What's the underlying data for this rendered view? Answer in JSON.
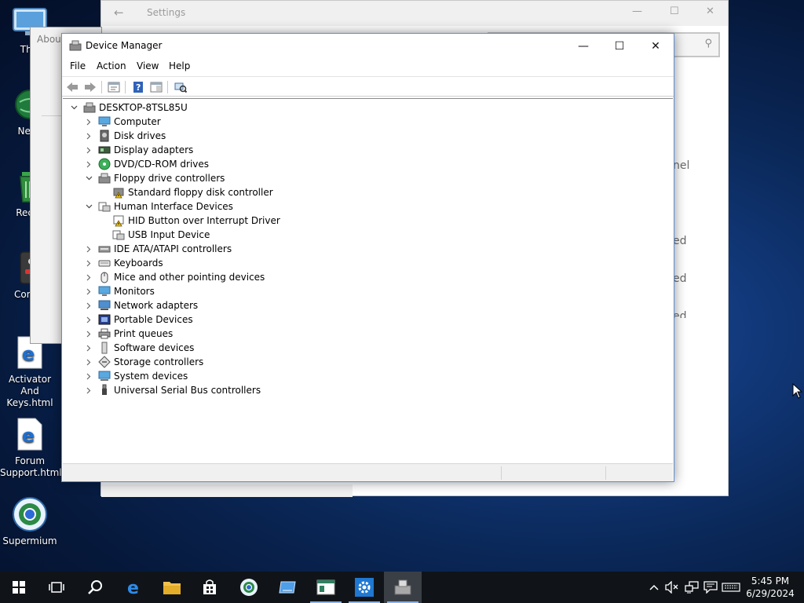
{
  "desktop": {
    "icons": [
      {
        "label": "This PC",
        "icon": "monitor-icon"
      },
      {
        "label": "Network",
        "icon": "network-globe-icon"
      },
      {
        "label": "Recycle Bin",
        "icon": "recycle-bin-icon"
      },
      {
        "label": "Control Panel",
        "icon": "control-panel-icon"
      },
      {
        "label": "Activator And Keys.html",
        "icon": "edge-html-file-icon"
      },
      {
        "label": "Forum Support.html",
        "icon": "edge-html-file-icon"
      },
      {
        "label": "Supermium",
        "icon": "supermium-browser-icon"
      }
    ],
    "truncated_labels": [
      "This",
      "Netw",
      "Recyc",
      "Contro"
    ]
  },
  "about_window": {
    "title": "About"
  },
  "settings_window": {
    "title": "Settings",
    "fragments": [
      "nel",
      "ed",
      "ed",
      "ed"
    ]
  },
  "device_manager": {
    "title": "Device Manager",
    "menu": [
      "File",
      "Action",
      "View",
      "Help"
    ],
    "toolbar": [
      "back-arrow-icon",
      "forward-arrow-icon",
      "properties-icon",
      "help-icon",
      "view-icon",
      "scan-hardware-icon"
    ],
    "tree_root": "DESKTOP-8TSL85U",
    "categories": [
      {
        "label": "Computer",
        "icon": "computer-icon",
        "expanded": false,
        "children": []
      },
      {
        "label": "Disk drives",
        "icon": "disk-drive-icon",
        "expanded": false,
        "children": []
      },
      {
        "label": "Display adapters",
        "icon": "display-adapter-icon",
        "expanded": false,
        "children": []
      },
      {
        "label": "DVD/CD-ROM drives",
        "icon": "dvd-icon",
        "expanded": false,
        "children": []
      },
      {
        "label": "Floppy drive controllers",
        "icon": "floppy-controller-icon",
        "expanded": true,
        "children": [
          {
            "label": "Standard floppy disk controller",
            "icon": "warning-device-icon"
          }
        ]
      },
      {
        "label": "Human Interface Devices",
        "icon": "hid-icon",
        "expanded": true,
        "children": [
          {
            "label": "HID Button over Interrupt Driver",
            "icon": "warning-device-icon"
          },
          {
            "label": "USB Input Device",
            "icon": "hid-device-icon"
          }
        ]
      },
      {
        "label": "IDE ATA/ATAPI controllers",
        "icon": "ide-controller-icon",
        "expanded": false,
        "children": []
      },
      {
        "label": "Keyboards",
        "icon": "keyboard-icon",
        "expanded": false,
        "children": []
      },
      {
        "label": "Mice and other pointing devices",
        "icon": "mouse-icon",
        "expanded": false,
        "children": []
      },
      {
        "label": "Monitors",
        "icon": "monitor-icon",
        "expanded": false,
        "children": []
      },
      {
        "label": "Network adapters",
        "icon": "network-adapter-icon",
        "expanded": false,
        "children": []
      },
      {
        "label": "Portable Devices",
        "icon": "portable-device-icon",
        "expanded": false,
        "children": []
      },
      {
        "label": "Print queues",
        "icon": "printer-icon",
        "expanded": false,
        "children": []
      },
      {
        "label": "Software devices",
        "icon": "software-device-icon",
        "expanded": false,
        "children": []
      },
      {
        "label": "Storage controllers",
        "icon": "storage-controller-icon",
        "expanded": false,
        "children": []
      },
      {
        "label": "System devices",
        "icon": "system-device-icon",
        "expanded": false,
        "children": []
      },
      {
        "label": "Universal Serial Bus controllers",
        "icon": "usb-icon",
        "expanded": false,
        "children": []
      }
    ]
  },
  "taskbar": {
    "items": [
      "start-icon",
      "task-view-icon",
      "search-icon",
      "edge-icon",
      "file-explorer-icon",
      "store-icon",
      "supermium-icon",
      "device-manager-shortcut-icon",
      "app-icon",
      "settings-gear-icon",
      "device-manager-icon"
    ],
    "tray": [
      "chevron-up-icon",
      "volume-muted-icon",
      "network-icon",
      "notifications-icon",
      "keyboard-icon"
    ],
    "time": "5:45 PM",
    "date": "6/29/2024"
  },
  "colors": {
    "accent": "#0078d7",
    "taskbar": "#101418",
    "title_accent": "#5a8fd6"
  }
}
